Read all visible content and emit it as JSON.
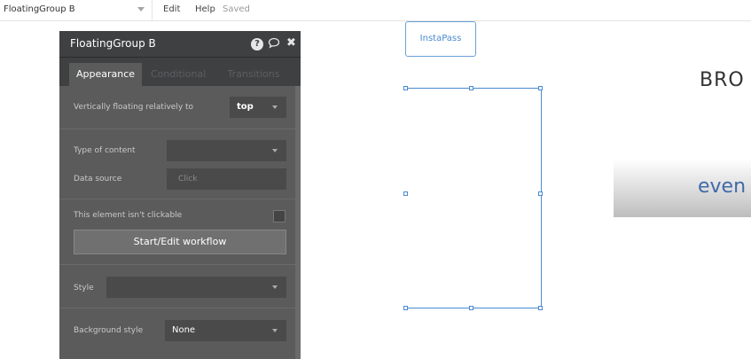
{
  "topbar": {
    "element_selector": "FloatingGroup B",
    "menu_edit": "Edit",
    "menu_help": "Help",
    "status": "Saved"
  },
  "canvas": {
    "button_label": "InstaPass",
    "heading_partial": "BRO",
    "banner_partial": "even"
  },
  "panel": {
    "title": "FloatingGroup B",
    "tabs": [
      "Appearance",
      "Conditional",
      "Transitions"
    ],
    "vertical_float_label": "Vertically floating relatively to",
    "vertical_float_value": "top",
    "type_of_content_label": "Type of content",
    "type_of_content_value": "",
    "data_source_label": "Data source",
    "data_source_placeholder": "Click",
    "not_clickable_label": "This element isn't clickable",
    "workflow_button": "Start/Edit workflow",
    "style_label": "Style",
    "style_value": "",
    "background_style_label": "Background style",
    "background_style_value": "None"
  },
  "colors": {
    "accent": "#4a8bd0",
    "panel_bg": "#5b5b5b",
    "panel_header": "#3e4042"
  }
}
